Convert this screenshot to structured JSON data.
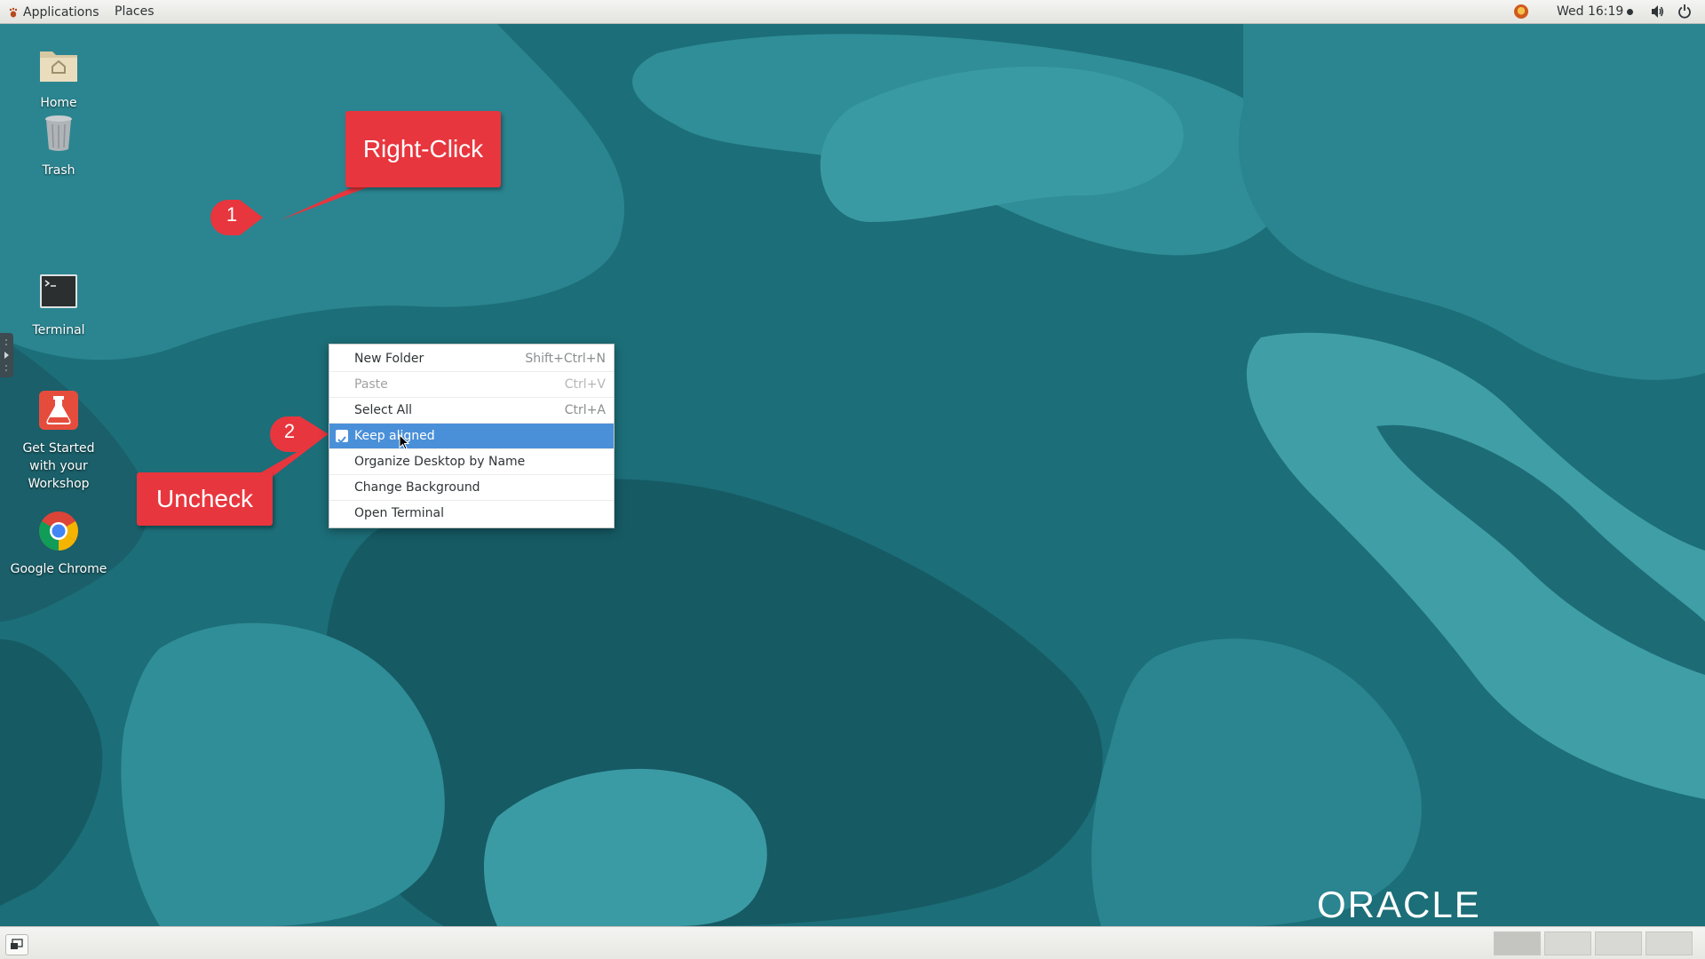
{
  "topbar": {
    "applications_label": "Applications",
    "places_label": "Places",
    "clock": "Wed 16:19"
  },
  "desktop_icons": [
    {
      "label": "Home",
      "icon": "home-folder-icon"
    },
    {
      "label": "Trash",
      "icon": "trash-icon"
    },
    {
      "label": "Terminal",
      "icon": "terminal-icon"
    },
    {
      "label": "Get Started with your Workshop",
      "icon": "workshop-icon"
    },
    {
      "label": "Google Chrome",
      "icon": "chrome-icon"
    }
  ],
  "context_menu": {
    "items": [
      {
        "label": "New Folder",
        "accel": "Shift+Ctrl+N"
      },
      {
        "label": "Paste",
        "accel": "Ctrl+V",
        "disabled": true
      },
      {
        "label": "Select All",
        "accel": "Ctrl+A"
      },
      {
        "label": "Keep aligned",
        "checked": true,
        "highlighted": true
      },
      {
        "label": "Organize Desktop by Name"
      },
      {
        "label": "Change Background"
      },
      {
        "label": "Open Terminal"
      }
    ]
  },
  "callouts": {
    "step1_number": "1",
    "step1_label": "Right-Click",
    "step2_number": "2",
    "step2_label": "Uncheck"
  },
  "branding": {
    "logo_text": "ORACLE"
  },
  "colors": {
    "callout": "#e8363e",
    "menu_highlight": "#4a90d9",
    "wallpaper_base": "#1c6e78"
  }
}
